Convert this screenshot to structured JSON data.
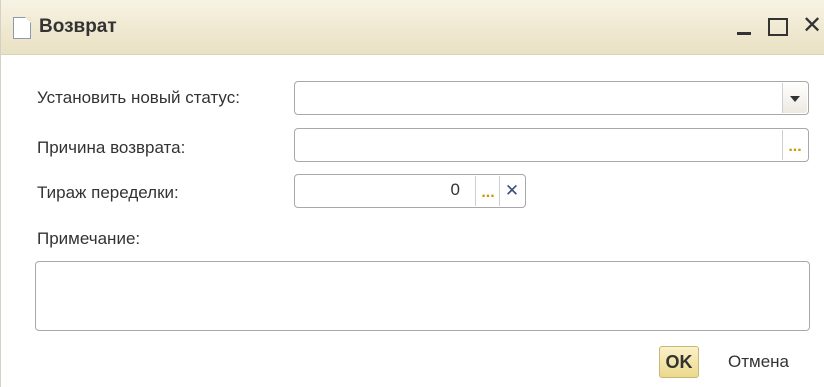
{
  "window": {
    "title": "Возврат",
    "minimize_glyph": "_",
    "maximize_glyph": "□",
    "close_glyph": "✕"
  },
  "form": {
    "status_label": "Установить новый статус:",
    "status_value": "",
    "reason_label": "Причина возврата:",
    "reason_value": "",
    "rework_label": "Тираж переделки:",
    "rework_value": "0",
    "note_label": "Примечание:",
    "note_value": ""
  },
  "buttons": {
    "ok": "OK",
    "cancel": "Отмена",
    "dots": "...",
    "clear": "✕"
  }
}
